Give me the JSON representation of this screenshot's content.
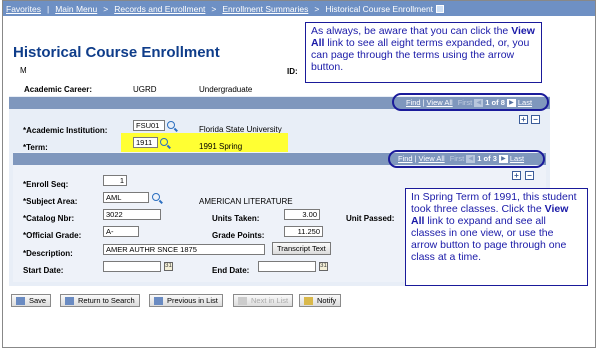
{
  "breadcrumb": {
    "items": [
      "Favorites",
      "Main Menu",
      "Records and Enrollment",
      "Enrollment Summaries",
      "Historical Course Enrollment"
    ],
    "separator": "|",
    "arrow": ">"
  },
  "page": {
    "title": "Historical Course Enrollment",
    "name_stub": "M",
    "id_label": "ID:"
  },
  "career": {
    "label": "Academic Career:",
    "code": "UGRD",
    "desc": "Undergraduate"
  },
  "term_nav": {
    "find": "Find",
    "view_all": "View All",
    "first": "First",
    "count": "1 of 8",
    "last": "Last"
  },
  "institution": {
    "label": "*Academic Institution:",
    "value": "FSU01",
    "desc": "Florida State University"
  },
  "term": {
    "label": "*Term:",
    "value": "1911",
    "desc": "1991 Spring"
  },
  "class_nav": {
    "find": "Find",
    "view_all": "View All",
    "first": "First",
    "count": "1 of 3",
    "last": "Last"
  },
  "enrollment": {
    "enroll_seq_label": "*Enroll Seq:",
    "enroll_seq": "1",
    "subject_label": "*Subject Area:",
    "subject": "AML",
    "subject_desc": "AMERICAN LITERATURE",
    "catalog_label": "*Catalog Nbr:",
    "catalog": "3022",
    "units_taken_label": "Units Taken:",
    "units_taken": "3.00",
    "unit_passed_label": "Unit Passed:",
    "grade_label": "*Official Grade:",
    "grade": "A-",
    "grade_points_label": "Grade Points:",
    "grade_points": "11.250",
    "desc_label": "*Description:",
    "desc": "AMER AUTHR SNCE 1875",
    "transcript_btn": "Transcript Text",
    "start_label": "Start Date:",
    "end_label": "End Date:"
  },
  "buttons": {
    "save": "Save",
    "return": "Return to Search",
    "prev": "Previous in List",
    "next": "Next in List",
    "notify": "Notify"
  },
  "callouts": {
    "top": {
      "pre": "As always, be aware that you can click the ",
      "bold": "View All",
      "post": " link to see all eight terms expanded, or, you can page through the terms using the arrow button."
    },
    "right": {
      "pre": "In Spring Term of 1991, this student took three classes. Click the ",
      "bold": "View All",
      "post": " link to expand and see all classes in one view, or use the arrow button to page through one class at a time."
    }
  },
  "colors": {
    "topbar": "#6e90c4",
    "title": "#0f3d8a",
    "highlight": "#ffff33",
    "callout_text": "#1a1aa8",
    "navbar": "#7f97bd"
  }
}
